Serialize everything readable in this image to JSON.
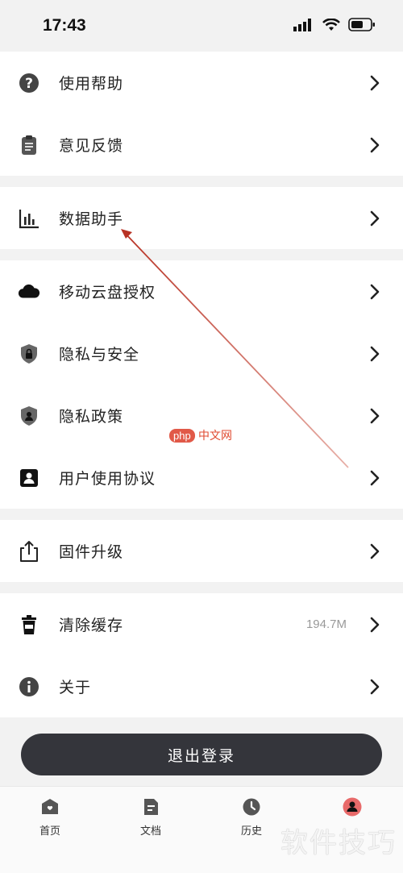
{
  "status": {
    "time": "17:43"
  },
  "menu": {
    "group1": [
      {
        "label": "使用帮助",
        "icon": "help-icon"
      },
      {
        "label": "意见反馈",
        "icon": "clipboard-icon"
      }
    ],
    "group2": [
      {
        "label": "数据助手",
        "icon": "bar-chart-icon"
      }
    ],
    "group3": [
      {
        "label": "移动云盘授权",
        "icon": "cloud-icon"
      },
      {
        "label": "隐私与安全",
        "icon": "shield-lock-icon"
      },
      {
        "label": "隐私政策",
        "icon": "shield-user-icon"
      },
      {
        "label": "用户使用协议",
        "icon": "user-card-icon"
      }
    ],
    "group4": [
      {
        "label": "固件升级",
        "icon": "upload-icon"
      }
    ],
    "group5": [
      {
        "label": "清除缓存",
        "icon": "trash-cup-icon",
        "value": "194.7M"
      },
      {
        "label": "关于",
        "icon": "info-icon"
      }
    ]
  },
  "logout": {
    "label": "退出登录"
  },
  "tabs": [
    {
      "label": "首页",
      "icon": "home-icon"
    },
    {
      "label": "文档",
      "icon": "document-icon"
    },
    {
      "label": "历史",
      "icon": "clock-icon"
    },
    {
      "label": "",
      "icon": "profile-icon"
    }
  ],
  "watermarks": {
    "php_logo": "php",
    "php_cn": "中文网",
    "site": "软件技巧"
  },
  "colors": {
    "logout_bg": "#34353b",
    "profile_accent": "#e86a6a",
    "arrow": "#c0392b"
  }
}
